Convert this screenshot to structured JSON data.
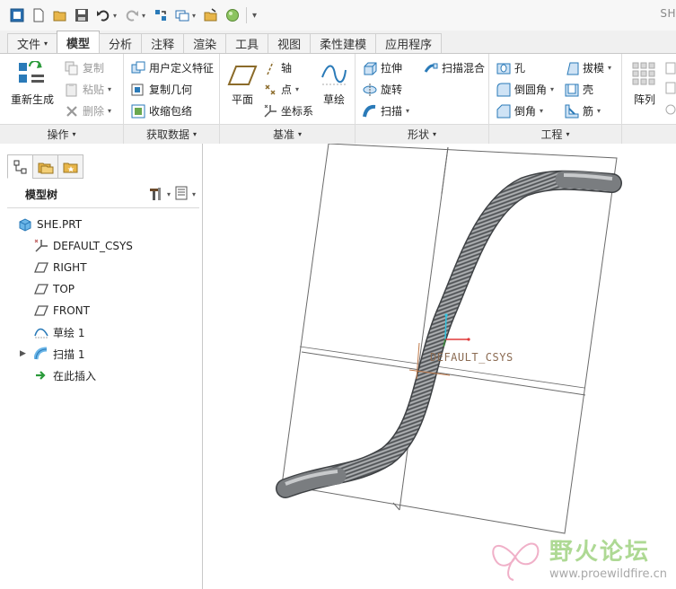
{
  "window": {
    "title": "SH"
  },
  "tabs": [
    {
      "label": "文件",
      "has_dropdown": true
    },
    {
      "label": "模型",
      "active": true
    },
    {
      "label": "分析"
    },
    {
      "label": "注释"
    },
    {
      "label": "渲染"
    },
    {
      "label": "工具"
    },
    {
      "label": "视图"
    },
    {
      "label": "柔性建模"
    },
    {
      "label": "应用程序"
    }
  ],
  "ribbon": {
    "operations": {
      "label": "操作",
      "regenerate": "重新生成",
      "copy": "复制",
      "paste": "粘贴",
      "delete": "删除"
    },
    "get_data": {
      "label": "获取数据",
      "udf": "用户定义特征",
      "copy_geometry": "复制几何",
      "shrinkwrap": "收缩包络"
    },
    "datum": {
      "label": "基准",
      "plane": "平面",
      "axis": "轴",
      "point": "点",
      "csys": "坐标系",
      "sketch": "草绘"
    },
    "shapes": {
      "label": "形状",
      "extrude": "拉伸",
      "revolve": "旋转",
      "sweep": "扫描",
      "swept_blend": "扫描混合"
    },
    "engineering": {
      "label": "工程",
      "hole": "孔",
      "round": "倒圆角",
      "chamfer": "倒角",
      "draft": "拔模",
      "shell": "壳",
      "rib": "筋"
    },
    "pattern": {
      "label": "阵列"
    }
  },
  "model_tree": {
    "title": "模型树",
    "items": [
      {
        "label": "SHE.PRT",
        "icon": "part-icon"
      },
      {
        "label": "DEFAULT_CSYS",
        "icon": "csys-icon"
      },
      {
        "label": "RIGHT",
        "icon": "datum-plane-icon"
      },
      {
        "label": "TOP",
        "icon": "datum-plane-icon"
      },
      {
        "label": "FRONT",
        "icon": "datum-plane-icon"
      },
      {
        "label": "草绘 1",
        "icon": "sketch-icon"
      },
      {
        "label": "扫描 1",
        "icon": "sweep-icon",
        "expandable": true
      },
      {
        "label": "在此插入",
        "icon": "insert-here-icon"
      }
    ]
  },
  "viewport": {
    "csys_label": "DEFAULT_CSYS",
    "watermark": {
      "text": "野火论坛",
      "url": "www.proewildfire.cn"
    }
  },
  "colors": {
    "tube": "#7a7d80",
    "tube_highlight": "#c8cacc",
    "csys_label": "#8b6b52",
    "datum_lines": "#6a6a6a",
    "watermark_green": "#9bd07a",
    "accent_blue": "#2a7ab8"
  }
}
